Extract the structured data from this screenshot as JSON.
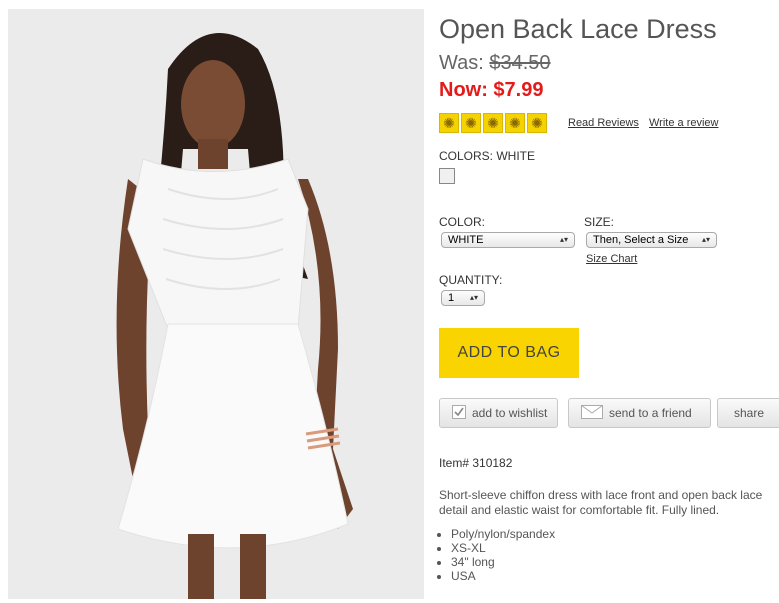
{
  "product": {
    "title": "Open Back Lace Dress",
    "was_label": "Was: ",
    "was_price": "$34.50",
    "now_text": "Now: $7.99"
  },
  "reviews": {
    "star_count": 5,
    "read_label": "Read Reviews",
    "write_label": "Write a review"
  },
  "colors": {
    "label": "COLORS: WHITE",
    "swatch_color": "#f0f0f0"
  },
  "options": {
    "color_label": "COLOR:",
    "color_value": "WHITE",
    "size_label": "SIZE:",
    "size_value": "Then, Select a Size",
    "size_chart_label": "Size Chart",
    "quantity_label": "QUANTITY:",
    "quantity_value": "1"
  },
  "actions": {
    "add_to_bag": "ADD TO BAG",
    "wishlist": "add to wishlist",
    "send_friend": "send to a friend",
    "share": "share"
  },
  "details": {
    "item_number": "Item# 310182",
    "description": "Short-sleeve chiffon dress with lace front and open back lace detail and elastic waist for comfortable fit. Fully lined.",
    "bullets": [
      "Poly/nylon/spandex",
      "XS-XL",
      "34\" long",
      "USA"
    ]
  },
  "colors_theme": {
    "accent_yellow": "#f9d400",
    "sale_red": "#e31b1b"
  }
}
